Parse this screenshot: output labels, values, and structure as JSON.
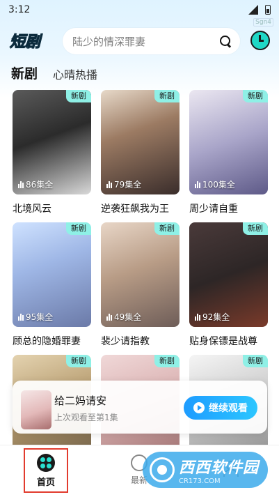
{
  "status_bar": {
    "time": "3:12"
  },
  "header": {
    "logo_text": "短剧",
    "search_placeholder": "陆少的情深罪妻",
    "top_watermark": "Sgn4"
  },
  "tabs": [
    {
      "label": "新剧",
      "active": true
    },
    {
      "label": "心晴热播",
      "active": false
    }
  ],
  "badge_label": "新剧",
  "dramas": [
    {
      "title": "北境风云",
      "episodes": "86集全"
    },
    {
      "title": "逆袭狂飙我为王",
      "episodes": "79集全"
    },
    {
      "title": "周少请自重",
      "episodes": "100集全"
    },
    {
      "title": "顾总的隐婚罪妻",
      "episodes": "95集全"
    },
    {
      "title": "裴少请指教",
      "episodes": "49集全"
    },
    {
      "title": "贴身保镖是战尊",
      "episodes": "92集全"
    },
    {
      "title": "",
      "episodes": ""
    },
    {
      "title": "",
      "episodes": ""
    },
    {
      "title": "",
      "episodes": ""
    }
  ],
  "continue_watching": {
    "title": "给二妈请安",
    "subtitle": "上次观看至第1集",
    "button_label": "继续观看"
  },
  "bottom_nav": {
    "home": "首页",
    "latest": "最新",
    "mine": ""
  },
  "site_watermark": {
    "main": "西西软件园",
    "sub": "CR173.COM"
  },
  "colors": {
    "accent": "#29e0cf",
    "button": "#1e9cff",
    "home_highlight_border": "#e23b2e"
  }
}
